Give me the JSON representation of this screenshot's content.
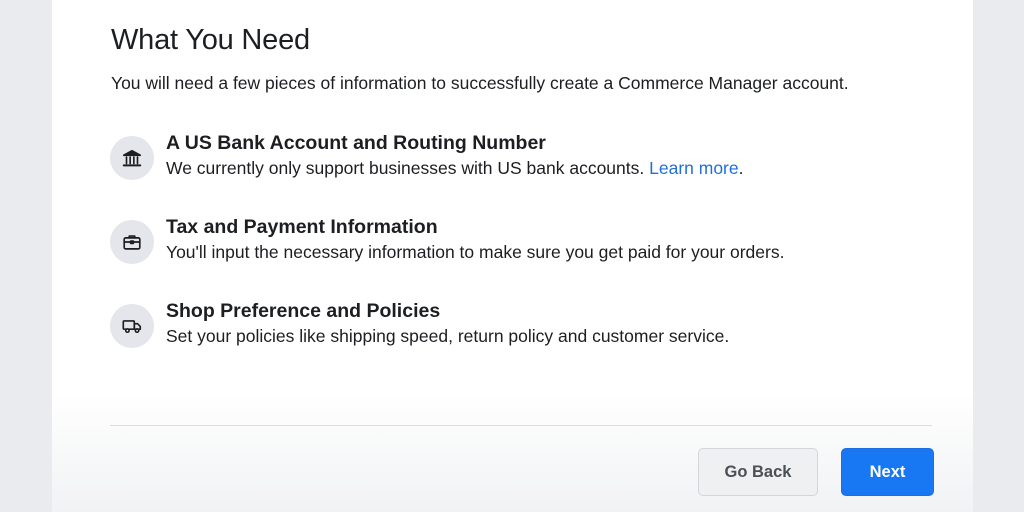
{
  "dialog": {
    "title": "What You Need",
    "intro": "You will need a few pieces of information to successfully create a Commerce Manager account."
  },
  "requirements": [
    {
      "icon": "bank-icon",
      "title": "A US Bank Account and Routing Number",
      "description": "We currently only support businesses with US bank accounts.",
      "link_label": "Learn more",
      "link_suffix": "."
    },
    {
      "icon": "briefcase-icon",
      "title": "Tax and Payment Information",
      "description": "You'll input the necessary information to make sure you get paid for your orders."
    },
    {
      "icon": "truck-icon",
      "title": "Shop Preference and Policies",
      "description": "Set your policies like shipping speed, return policy and customer service."
    }
  ],
  "footer": {
    "back_label": "Go Back",
    "next_label": "Next"
  },
  "colors": {
    "primary": "#1877f2",
    "link": "#216fdb",
    "text": "#1c1e21",
    "icon_bg": "#e4e6eb"
  }
}
